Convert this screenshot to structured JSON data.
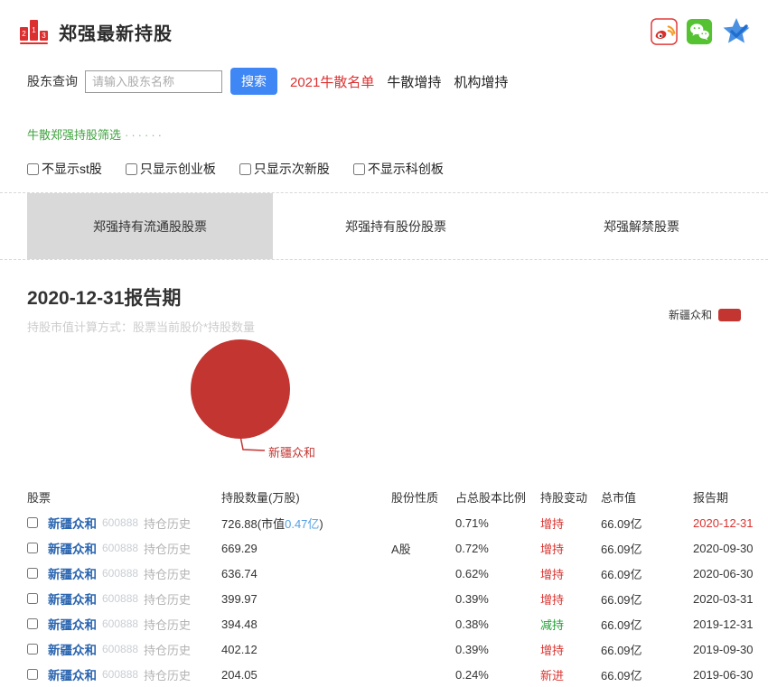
{
  "header": {
    "title": "郑强最新持股",
    "logo_numbers": [
      "2",
      "1",
      "3"
    ]
  },
  "social": {
    "icons": [
      "weibo-share",
      "wechat-share",
      "favorite-star"
    ]
  },
  "search": {
    "label": "股东查询",
    "placeholder": "请输入股东名称",
    "button": "搜索",
    "links": [
      {
        "text": "2021牛散名单",
        "highlight": true
      },
      {
        "text": "牛散增持",
        "highlight": false
      },
      {
        "text": "机构增持",
        "highlight": false
      }
    ]
  },
  "filter": {
    "title": "牛散郑强持股筛选",
    "dots": "······",
    "checkboxes": [
      "不显示st股",
      "只显示创业板",
      "只显示次新股",
      "不显示科创板"
    ]
  },
  "tabs": [
    {
      "label": "郑强持有流通股股票",
      "active": true
    },
    {
      "label": "郑强持有股份股票",
      "active": false
    },
    {
      "label": "郑强解禁股票",
      "active": false
    }
  ],
  "report": {
    "title": "2020-12-31报告期",
    "subtitle": "持股市值计算方式：股票当前股价*持股数量"
  },
  "chart_data": {
    "type": "pie",
    "title": "",
    "slices": [
      {
        "label": "新疆众和",
        "value": 100,
        "color": "#c23531"
      }
    ],
    "legend": [
      {
        "label": "新疆众和",
        "color": "#c23531"
      }
    ],
    "legend_position": "top-right",
    "callout_label": "新疆众和"
  },
  "table": {
    "columns": [
      "股票",
      "持股数量(万股)",
      "股份性质",
      "占总股本比例",
      "持股变动",
      "总市值",
      "报告期"
    ],
    "history_label": "持仓历史",
    "rows": [
      {
        "name": "新疆众和",
        "code": "600888",
        "quantity": "726.88",
        "note": {
          "prefix": "(市值",
          "value": "0.47亿",
          "suffix": ")"
        },
        "nature": "",
        "ratio": "0.71%",
        "change": "增持",
        "change_type": "up",
        "total": "66.09亿",
        "date": "2020-12-31",
        "date_highlight": true
      },
      {
        "name": "新疆众和",
        "code": "600888",
        "quantity": "669.29",
        "note": null,
        "nature": "A股",
        "ratio": "0.72%",
        "change": "增持",
        "change_type": "up",
        "total": "66.09亿",
        "date": "2020-09-30",
        "date_highlight": false
      },
      {
        "name": "新疆众和",
        "code": "600888",
        "quantity": "636.74",
        "note": null,
        "nature": "",
        "ratio": "0.62%",
        "change": "增持",
        "change_type": "up",
        "total": "66.09亿",
        "date": "2020-06-30",
        "date_highlight": false
      },
      {
        "name": "新疆众和",
        "code": "600888",
        "quantity": "399.97",
        "note": null,
        "nature": "",
        "ratio": "0.39%",
        "change": "增持",
        "change_type": "up",
        "total": "66.09亿",
        "date": "2020-03-31",
        "date_highlight": false
      },
      {
        "name": "新疆众和",
        "code": "600888",
        "quantity": "394.48",
        "note": null,
        "nature": "",
        "ratio": "0.38%",
        "change": "减持",
        "change_type": "down",
        "total": "66.09亿",
        "date": "2019-12-31",
        "date_highlight": false
      },
      {
        "name": "新疆众和",
        "code": "600888",
        "quantity": "402.12",
        "note": null,
        "nature": "",
        "ratio": "0.39%",
        "change": "增持",
        "change_type": "up",
        "total": "66.09亿",
        "date": "2019-09-30",
        "date_highlight": false
      },
      {
        "name": "新疆众和",
        "code": "600888",
        "quantity": "204.05",
        "note": null,
        "nature": "",
        "ratio": "0.24%",
        "change": "新进",
        "change_type": "new",
        "total": "66.09亿",
        "date": "2019-06-30",
        "date_highlight": false
      }
    ]
  },
  "colors": {
    "accent_red": "#dc3030",
    "up_red": "#d9332f",
    "down_green": "#21a035",
    "link_blue": "#2a65b0",
    "light_blue": "#55a0e3",
    "pie_red": "#c23531",
    "button_blue": "#3e87f5",
    "filter_green": "#3fa23f"
  }
}
